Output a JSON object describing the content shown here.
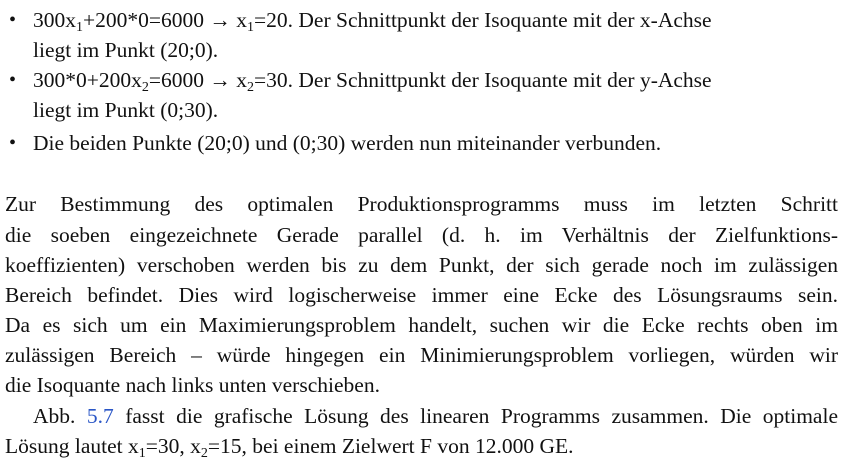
{
  "bullets": [
    {
      "line1_head": "300x",
      "line1_sub1": "1",
      "line1_mid": "+200*0=6000 → x",
      "line1_sub2": "1",
      "line1_tail": "=20. Der Schnittpunkt der Isoquante mit der x-Achse",
      "line2": "liegt im Punkt (20;0)."
    },
    {
      "line1_head": "300*0+200x",
      "line1_sub1": "2",
      "line1_mid": "=6000 → x",
      "line1_sub2": "2",
      "line1_tail": "=30. Der Schnittpunkt der Isoquante mit der y-Achse",
      "line2": "liegt im Punkt (0;30)."
    },
    {
      "line1": "Die beiden Punkte (20;0) und (0;30) werden nun miteinander verbunden."
    }
  ],
  "paragraph1": [
    "Zur Bestimmung des optimalen Produktionsprogramms muss im letzten Schritt",
    "die soeben eingezeichnete Gerade parallel (d. h. im Verhältnis der Zielfunktions-",
    "koeffizienten) verschoben werden bis zu dem Punkt, der sich gerade noch im zulässigen",
    "Bereich befindet. Dies wird logischerweise immer eine Ecke des Lösungsraums sein.",
    "Da es sich um ein Maximierungsproblem handelt, suchen wir die Ecke rechts oben im",
    "zulässigen Bereich – würde hingegen ein Minimierungsproblem vorliegen, würden wir",
    "die Isoquante nach links unten verschieben."
  ],
  "paragraph2": {
    "line1_pre": "Abb. ",
    "figure_ref": "5.7",
    "line1_post": " fasst die grafische Lösung des linearen Programms zusammen. Die optimale",
    "line2_a": "Lösung lautet x",
    "line2_sub1": "1",
    "line2_b": "=30, x",
    "line2_sub2": "2",
    "line2_c": "=15, bei einem Zielwert F von 12.000 GE."
  },
  "bullet_glyph": "•",
  "link_color": "#2a56c6"
}
